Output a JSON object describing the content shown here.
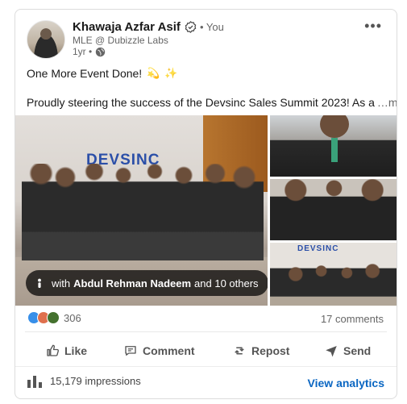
{
  "post": {
    "author_name": "Khawaja Azfar Asif",
    "degree": "• You",
    "headline": "MLE @ Dubizzle Labs",
    "age": "1yr •",
    "line1": "One More Event Done!",
    "emoji1": "💫",
    "emoji2": "✨",
    "line2": "Proudly steering the success of the Devsinc Sales Summit 2023! As a",
    "see_more": "…more"
  },
  "media": {
    "logo_text": "DEVSINC",
    "tag_prefix": "with",
    "tag_name": "Abdul Rehman Nadeem",
    "tag_suffix": "and 10 others"
  },
  "social": {
    "reaction_count": "306",
    "comments": "17 comments"
  },
  "actions": {
    "like": "Like",
    "comment": "Comment",
    "repost": "Repost",
    "send": "Send"
  },
  "footer": {
    "impressions": "15,179 impressions",
    "view_analytics": "View analytics"
  },
  "icons": [
    "verified-icon",
    "globe-icon",
    "more-icon",
    "person-icon",
    "like-icon",
    "comment-icon",
    "repost-icon",
    "send-icon",
    "bar-chart-icon"
  ],
  "colors": {
    "link": "#0a66c2",
    "like": "#378fe9",
    "love": "#df704d",
    "celebrate": "#44712e"
  }
}
